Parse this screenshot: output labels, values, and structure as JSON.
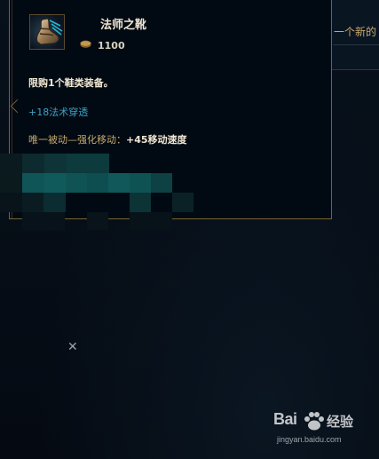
{
  "item": {
    "name": "法师之靴",
    "price": "1100",
    "limit_text": "限购1个鞋类装备。",
    "stat_text": "+18法术穿透",
    "passive_label": "唯一被动—强化移动：",
    "passive_value": "+45移动速度"
  },
  "background": {
    "side_text": "一个新的"
  },
  "watermark": {
    "brand": "Bai",
    "brand_suffix": "经验",
    "url": "jingyan.baidu.com"
  },
  "colors": {
    "border_gold": "#7a6331",
    "name": "#f0e6d2",
    "stat_blue": "#3ba3c6",
    "passive_gold": "#c8aa6e"
  },
  "icons": [
    "boots-of-sorcery-icon",
    "gold-coin-icon",
    "close-x-icon",
    "baidu-paw-icon"
  ]
}
